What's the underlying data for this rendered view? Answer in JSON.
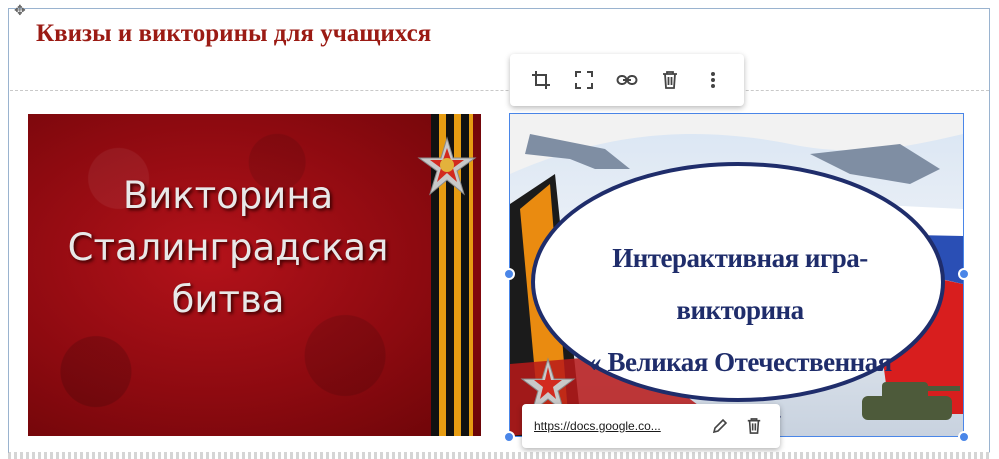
{
  "page": {
    "title": "Квизы и викторины для учащихся",
    "move_icon": "move-icon"
  },
  "toolbar": {
    "items": [
      {
        "name": "crop-icon",
        "label": "Crop"
      },
      {
        "name": "fullscreen-icon",
        "label": "Fit"
      },
      {
        "name": "link-icon",
        "label": "Link"
      },
      {
        "name": "delete-icon",
        "label": "Delete"
      },
      {
        "name": "more-icon",
        "label": "More"
      }
    ]
  },
  "images": {
    "left": {
      "lines": [
        "Викторина",
        "Сталинградская",
        "битва"
      ]
    },
    "right": {
      "lines": [
        "Интерактивная игра-викторина",
        "« Великая Отечественная война»"
      ]
    }
  },
  "link_popup": {
    "url": "https://docs.google.co..."
  },
  "colors": {
    "title": "#9b1b14",
    "selection": "#4a86e8",
    "right_text": "#1f2d6b"
  }
}
